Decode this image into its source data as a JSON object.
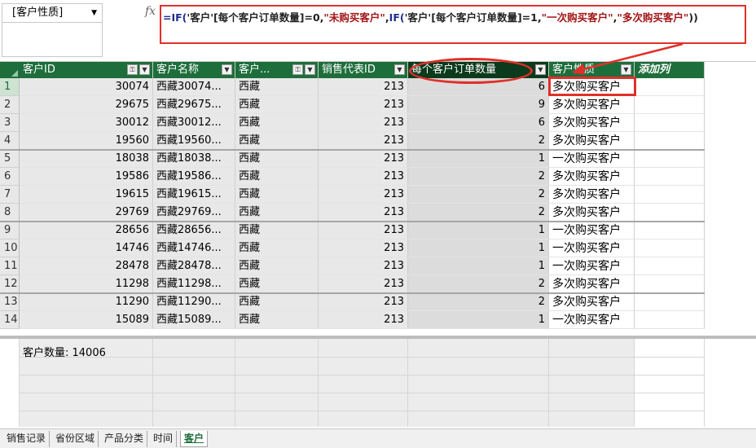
{
  "namebox": {
    "value": "[客户性质]"
  },
  "formula_bar": {
    "fx_label": "fx",
    "parts": [
      {
        "t": "=IF(",
        "c": "kw"
      },
      {
        "t": "'客户'[每个客户订单数量]=0,",
        "c": ""
      },
      {
        "t": "\"未购买客户\"",
        "c": "str"
      },
      {
        "t": ",",
        "c": ""
      },
      {
        "t": "IF(",
        "c": "kw"
      },
      {
        "t": "'客户'[每个客户订单数量]=1,",
        "c": ""
      },
      {
        "t": "\"一次购买客户\"",
        "c": "str"
      },
      {
        "t": ",",
        "c": ""
      },
      {
        "t": "\"多次购买客户\"",
        "c": "str"
      },
      {
        "t": "))",
        "c": ""
      }
    ]
  },
  "columns": [
    {
      "label": "客户ID",
      "icons": [
        "key",
        "dropdown"
      ]
    },
    {
      "label": "客户名称",
      "icons": [
        "dropdown"
      ]
    },
    {
      "label": "客户...",
      "icons": [
        "key",
        "dropdown"
      ]
    },
    {
      "label": "销售代表ID",
      "icons": [
        "dropdown"
      ]
    },
    {
      "label": "每个客户订单数量",
      "icons": [
        "dropdown"
      ]
    },
    {
      "label": "客户性质",
      "icons": [
        "dropdown"
      ]
    },
    {
      "label": "添加列",
      "icons": []
    }
  ],
  "rows": [
    {
      "n": "1",
      "id": "30074",
      "name": "西藏30074...",
      "region": "西藏",
      "rep": "213",
      "orders": "6",
      "type": "多次购买客户"
    },
    {
      "n": "2",
      "id": "29675",
      "name": "西藏29675...",
      "region": "西藏",
      "rep": "213",
      "orders": "9",
      "type": "多次购买客户"
    },
    {
      "n": "3",
      "id": "30012",
      "name": "西藏30012...",
      "region": "西藏",
      "rep": "213",
      "orders": "6",
      "type": "多次购买客户"
    },
    {
      "n": "4",
      "id": "19560",
      "name": "西藏19560...",
      "region": "西藏",
      "rep": "213",
      "orders": "2",
      "type": "多次购买客户"
    },
    {
      "n": "5",
      "id": "18038",
      "name": "西藏18038...",
      "region": "西藏",
      "rep": "213",
      "orders": "1",
      "type": "一次购买客户"
    },
    {
      "n": "6",
      "id": "19586",
      "name": "西藏19586...",
      "region": "西藏",
      "rep": "213",
      "orders": "2",
      "type": "多次购买客户"
    },
    {
      "n": "7",
      "id": "19615",
      "name": "西藏19615...",
      "region": "西藏",
      "rep": "213",
      "orders": "2",
      "type": "多次购买客户"
    },
    {
      "n": "8",
      "id": "29769",
      "name": "西藏29769...",
      "region": "西藏",
      "rep": "213",
      "orders": "2",
      "type": "多次购买客户"
    },
    {
      "n": "9",
      "id": "28656",
      "name": "西藏28656...",
      "region": "西藏",
      "rep": "213",
      "orders": "1",
      "type": "一次购买客户"
    },
    {
      "n": "10",
      "id": "14746",
      "name": "西藏14746...",
      "region": "西藏",
      "rep": "213",
      "orders": "1",
      "type": "一次购买客户"
    },
    {
      "n": "11",
      "id": "28478",
      "name": "西藏28478...",
      "region": "西藏",
      "rep": "213",
      "orders": "1",
      "type": "一次购买客户"
    },
    {
      "n": "12",
      "id": "11298",
      "name": "西藏11298...",
      "region": "西藏",
      "rep": "213",
      "orders": "2",
      "type": "多次购买客户"
    },
    {
      "n": "13",
      "id": "11290",
      "name": "西藏11290...",
      "region": "西藏",
      "rep": "213",
      "orders": "2",
      "type": "多次购买客户"
    },
    {
      "n": "14",
      "id": "15089",
      "name": "西藏15089...",
      "region": "西藏",
      "rep": "213",
      "orders": "1",
      "type": "一次购买客户"
    }
  ],
  "measure": {
    "text": "客户数量: 14006"
  },
  "sheet_tabs": [
    {
      "label": "销售记录",
      "active": false
    },
    {
      "label": "省份区域",
      "active": false
    },
    {
      "label": "产品分类",
      "active": false
    },
    {
      "label": "时间",
      "active": false
    },
    {
      "label": "客户",
      "active": true
    }
  ],
  "colors": {
    "header_green": "#1e6e3b",
    "annotation_red": "#e0302a"
  }
}
